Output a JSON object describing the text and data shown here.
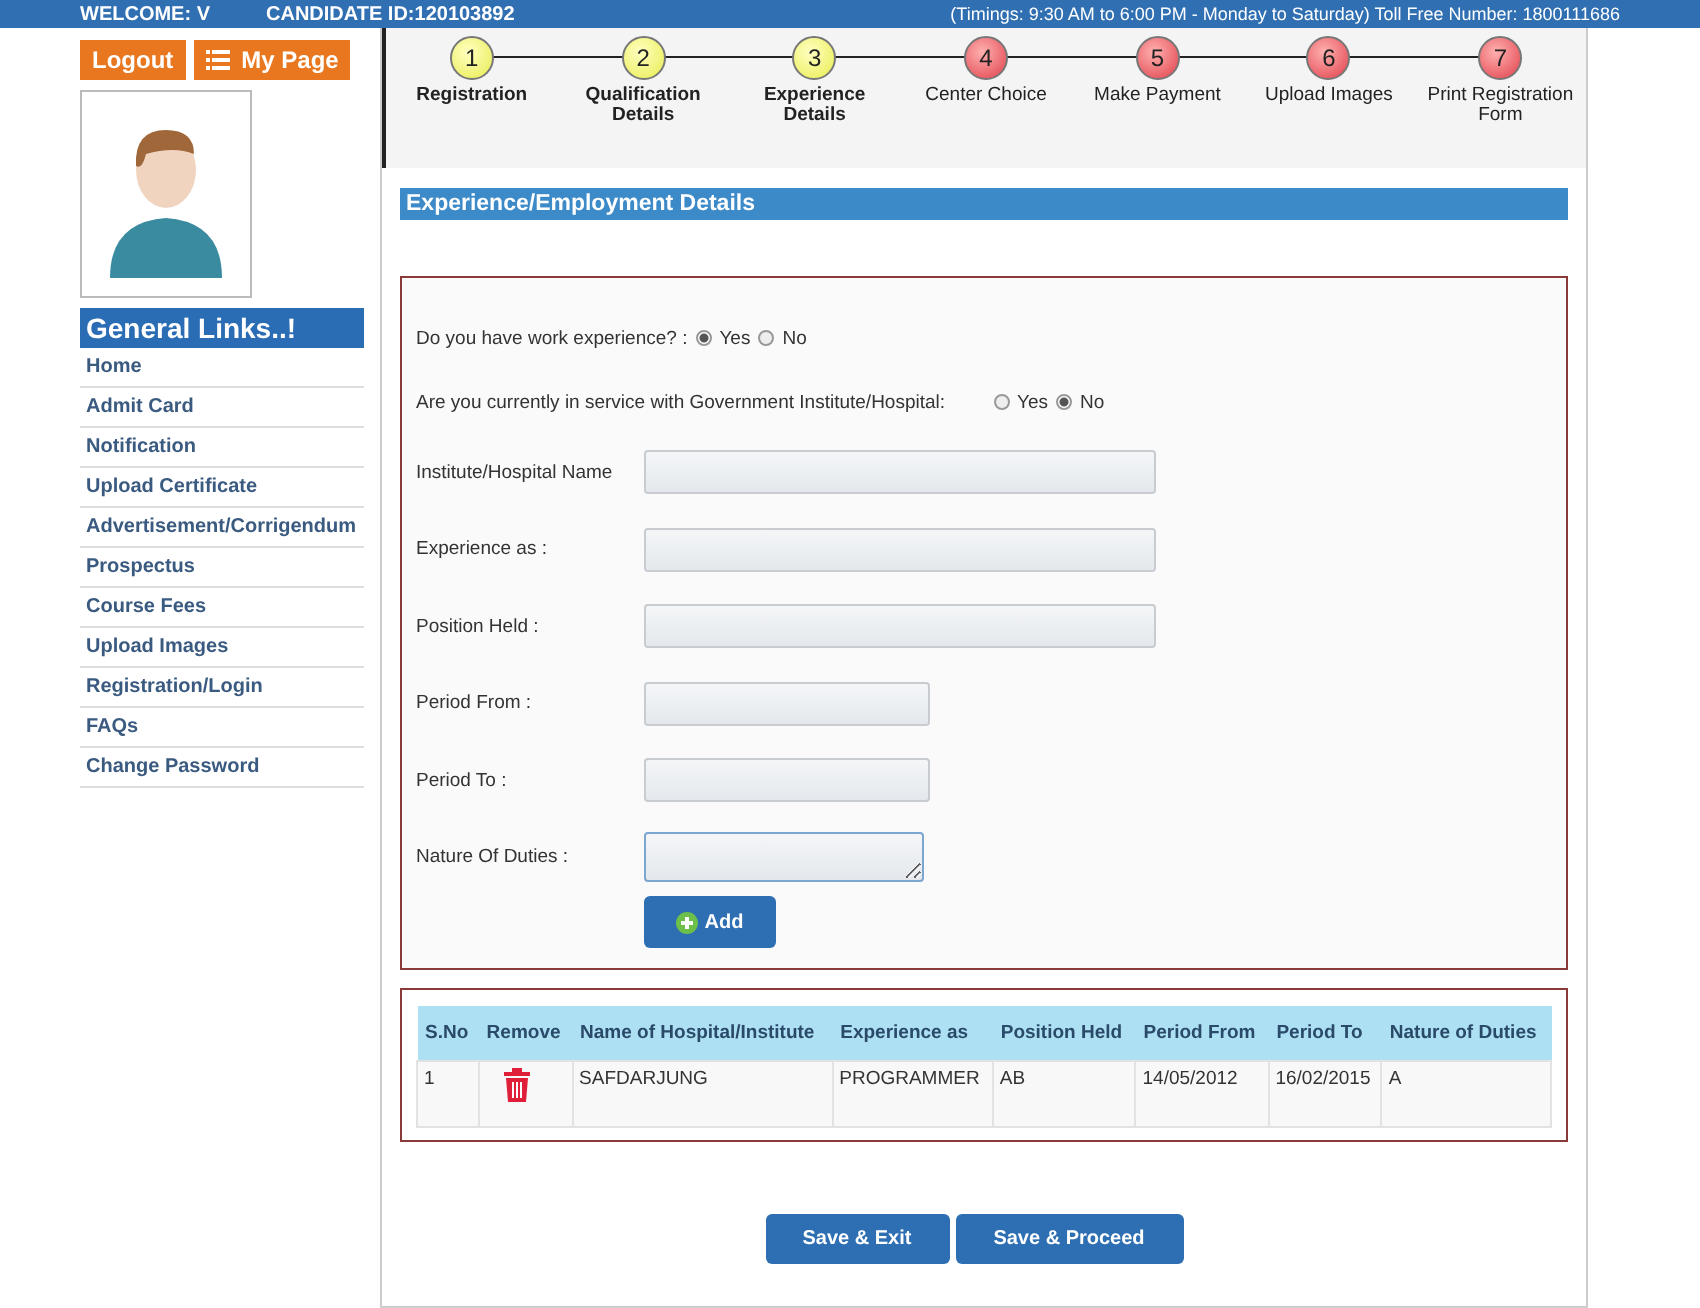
{
  "top_bar": {
    "welcome": "WELCOME: V",
    "candidate_id": "CANDIDATE ID:120103892",
    "timings": "(Timings: 9:30 AM to 6:00 PM - Monday to Saturday) Toll Free Number: 1800111686"
  },
  "user_buttons": [
    {
      "label": "Logout",
      "kind": "plain"
    },
    {
      "label": "My Page",
      "kind": "list"
    }
  ],
  "sidebar": {
    "title": "General Links..!",
    "items": [
      "Home",
      "Admit Card",
      "Notification",
      "Upload Certificate",
      "Advertisement/Corrigendum",
      "Prospectus",
      "Course Fees",
      "Upload Images",
      "Registration/Login",
      "FAQs",
      "Change Password"
    ]
  },
  "steps": [
    {
      "number": "1",
      "label": "Registration",
      "done": true
    },
    {
      "number": "2",
      "label": "Qualification Details",
      "done": true
    },
    {
      "number": "3",
      "label": "Experience Details",
      "done": true
    },
    {
      "number": "4",
      "label": "Center Choice",
      "done": false
    },
    {
      "number": "5",
      "label": "Make Payment",
      "done": false
    },
    {
      "number": "6",
      "label": "Upload Images",
      "done": false
    },
    {
      "number": "7",
      "label": "Print Registration Form",
      "done": false
    }
  ],
  "section_title": "Experience/Employment Details",
  "questions": [
    {
      "label": "Do you have work experience?  :",
      "options": [
        {
          "label": "Yes",
          "selected": true
        },
        {
          "label": "No",
          "selected": false
        }
      ]
    },
    {
      "label": "Are you currently in service with Government Institute/Hospital:",
      "options": [
        {
          "label": "Yes",
          "selected": false
        },
        {
          "label": "No",
          "selected": true
        }
      ]
    }
  ],
  "fields": [
    {
      "label": "Institute/Hospital Name",
      "kind": "wide"
    },
    {
      "label": "Experience as  :",
      "kind": "wide"
    },
    {
      "label": "Position Held  :",
      "kind": "wide"
    },
    {
      "label": "Period From  :",
      "kind": "short"
    },
    {
      "label": "Period To  :",
      "kind": "short"
    },
    {
      "label": "Nature Of Duties  :",
      "kind": "textarea"
    }
  ],
  "add_button": "Add",
  "table": {
    "columns": [
      "S.No",
      "Remove",
      "Name of Hospital/Institute",
      "Experience as",
      "Position Held",
      "Period From",
      "Period To",
      "Nature of Duties"
    ],
    "rows": [
      {
        "sno": "1",
        "name": "SAFDARJUNG",
        "experience": "PROGRAMMER",
        "position": "AB",
        "from": "14/05/2012",
        "to": "16/02/2015",
        "duties": "A"
      }
    ]
  },
  "buttons": [
    "Save & Exit",
    "Save & Proceed"
  ]
}
